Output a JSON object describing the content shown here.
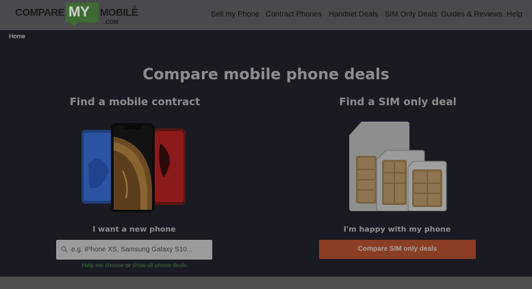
{
  "header": {
    "logo": {
      "word1": "COMPARE",
      "word2": "MY",
      "word3": "MOBILE",
      "reg": "®",
      "suffix": ".COM"
    },
    "nav": [
      "Sell my Phone",
      "Contract Phones",
      "Handset Deals",
      "SIM Only Deals",
      "Guides & Reviews",
      "Help"
    ]
  },
  "breadcrumb": "Home",
  "hero": {
    "title": "Compare mobile phone deals",
    "contract": {
      "heading": "Find a mobile contract",
      "subheading": "I want a new phone",
      "search_placeholder": "e.g. iPhone XS, Samsung Galaxy S10...",
      "help_link": "Help me choose",
      "help_or": "or",
      "all_phones_link": "show all phone deals"
    },
    "sim": {
      "heading": "Find a SIM only deal",
      "subheading": "I'm happy with my phone",
      "button": "Compare SIM only deals"
    }
  },
  "colors": {
    "header_bg": "#4a4a4e",
    "page_bg": "#1a1b22",
    "logo_green": "#3e6b33",
    "cta_orange": "#8a3e24"
  }
}
